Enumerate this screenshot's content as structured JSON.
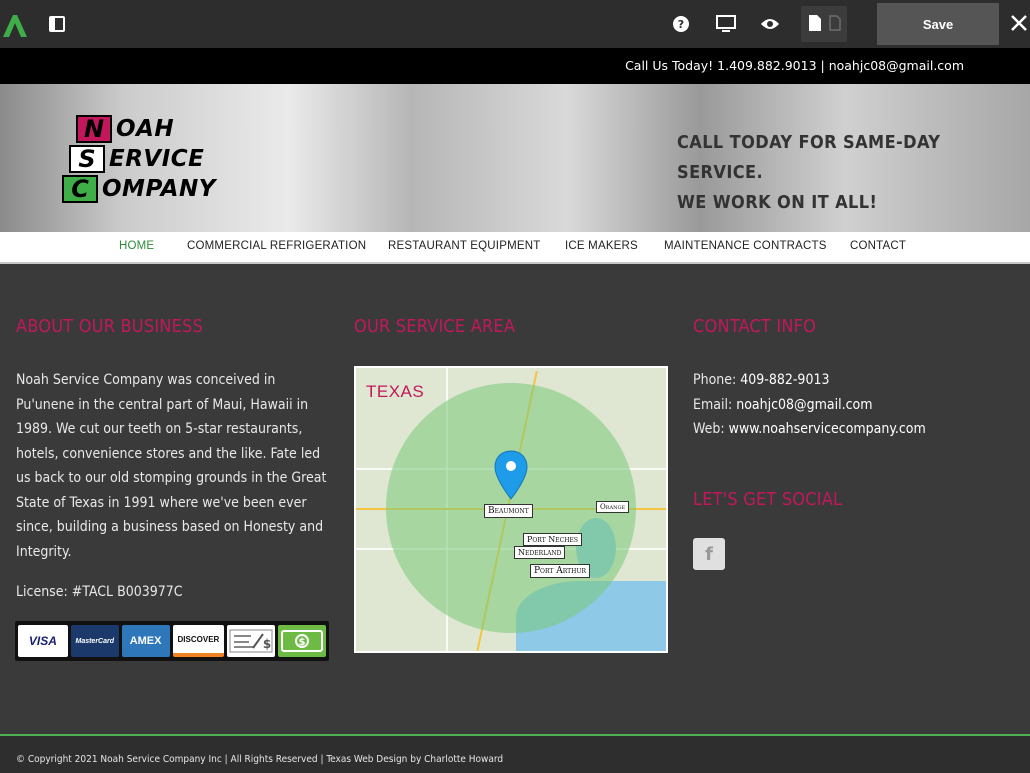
{
  "editor": {
    "save_label": "Save"
  },
  "topbar": {
    "contact_line": "Call Us Today! 1.409.882.9013 | noahjc08@gmail.com"
  },
  "brand": {
    "row1_letter": "N",
    "row1_word": "OAH",
    "row2_letter": "S",
    "row2_word": "ERVICE",
    "row3_letter": "C",
    "row3_word": "OMPANY"
  },
  "header": {
    "tagline_line1": "CALL TODAY FOR SAME-DAY SERVICE.",
    "tagline_line2": "WE WORK ON IT ALL!"
  },
  "nav": {
    "items": [
      {
        "label": "HOME"
      },
      {
        "label": "COMMERCIAL REFRIGERATION"
      },
      {
        "label": "RESTAURANT EQUIPMENT"
      },
      {
        "label": "ICE MAKERS"
      },
      {
        "label": "MAINTENANCE CONTRACTS"
      },
      {
        "label": "CONTACT"
      }
    ]
  },
  "about": {
    "title": "ABOUT OUR BUSINESS",
    "text": "Noah Service Company was conceived in Pu'unene in the central part of Maui, Hawaii in 1989. We cut our teeth on 5-star restaurants, hotels, convenience stores and the like. Fate led us back to our old stomping grounds in the Great State of Texas in 1991 where we've been ever since, building a business based on Honesty and Integrity.",
    "license": "License: #TACL B003977C",
    "payments": [
      "VISA",
      "MasterCard",
      "AMEX",
      "DISCOVER"
    ]
  },
  "service_area": {
    "title": "OUR SERVICE AREA",
    "map_title": "TEXAS",
    "cities": [
      "Beaumont",
      "Orange",
      "Port Neches",
      "Nederland",
      "Port Arthur"
    ]
  },
  "contact": {
    "title": "CONTACT INFO",
    "phone_label": "Phone:",
    "phone": "409-882-9013",
    "email_label": "Email:",
    "email": "noahjc08@gmail.com",
    "web_label": "Web:",
    "web": "www.noahservicecompany.com"
  },
  "social": {
    "title": "LET'S GET SOCIAL",
    "facebook": "f"
  },
  "footer": {
    "copyright": "© Copyright 2021 Noah Service Company Inc | All Rights Reserved | Texas Web Design by Charlotte Howard"
  },
  "colors": {
    "accent_pink": "#c2185b",
    "nav_active": "#2e8b3a",
    "footer_line": "#4caf50",
    "editor_logo": "#3fae49"
  }
}
